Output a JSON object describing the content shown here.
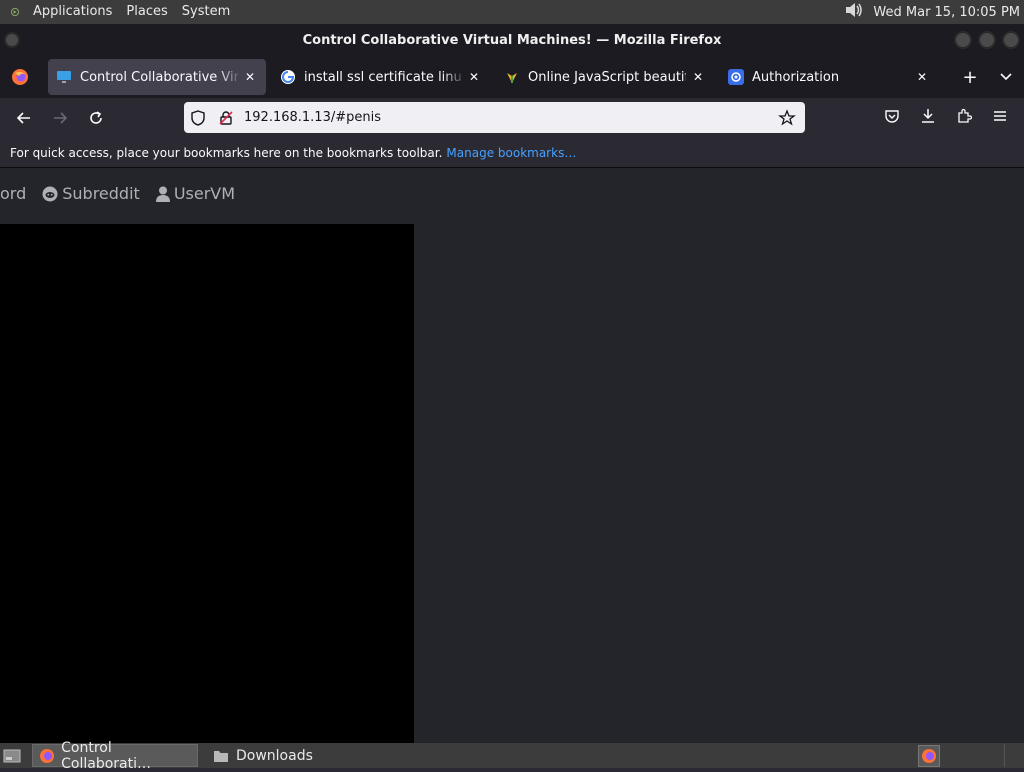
{
  "top_panel": {
    "menus": [
      "Applications",
      "Places",
      "System"
    ],
    "clock": "Wed Mar 15, 10:05 PM"
  },
  "window": {
    "title": "Control Collaborative Virtual Machines! — Mozilla Firefox"
  },
  "tabs": [
    {
      "title": "Control Collaborative Virtual Machines!",
      "favicon": "monitor-icon",
      "active": true
    },
    {
      "title": "install ssl certificate linux - Google Search",
      "favicon": "google-icon",
      "active": false
    },
    {
      "title": "Online JavaScript beautifier",
      "favicon": "beautifier-icon",
      "active": false
    },
    {
      "title": "Authorization",
      "favicon": "at-sign-icon",
      "active": false
    }
  ],
  "urlbar": {
    "url": "192.168.1.13/#penis"
  },
  "bookmarks": {
    "prompt": "For quick access, place your bookmarks here on the bookmarks toolbar.",
    "manage_link": "Manage bookmarks…"
  },
  "site_nav": {
    "items": [
      {
        "label": "ord",
        "icon": "discord-icon"
      },
      {
        "label": "Subreddit",
        "icon": "reddit-icon"
      },
      {
        "label": "UserVM",
        "icon": "user-icon"
      }
    ]
  },
  "taskbar": {
    "tasks": [
      {
        "label": "Control Collaborati…",
        "icon": "firefox-icon",
        "active": true
      },
      {
        "label": "Downloads",
        "icon": "folder-icon",
        "active": false
      }
    ]
  },
  "colors": {
    "accent_link": "#45a1ff",
    "tab_active": "#42414d",
    "vm_screen": "#000000"
  }
}
